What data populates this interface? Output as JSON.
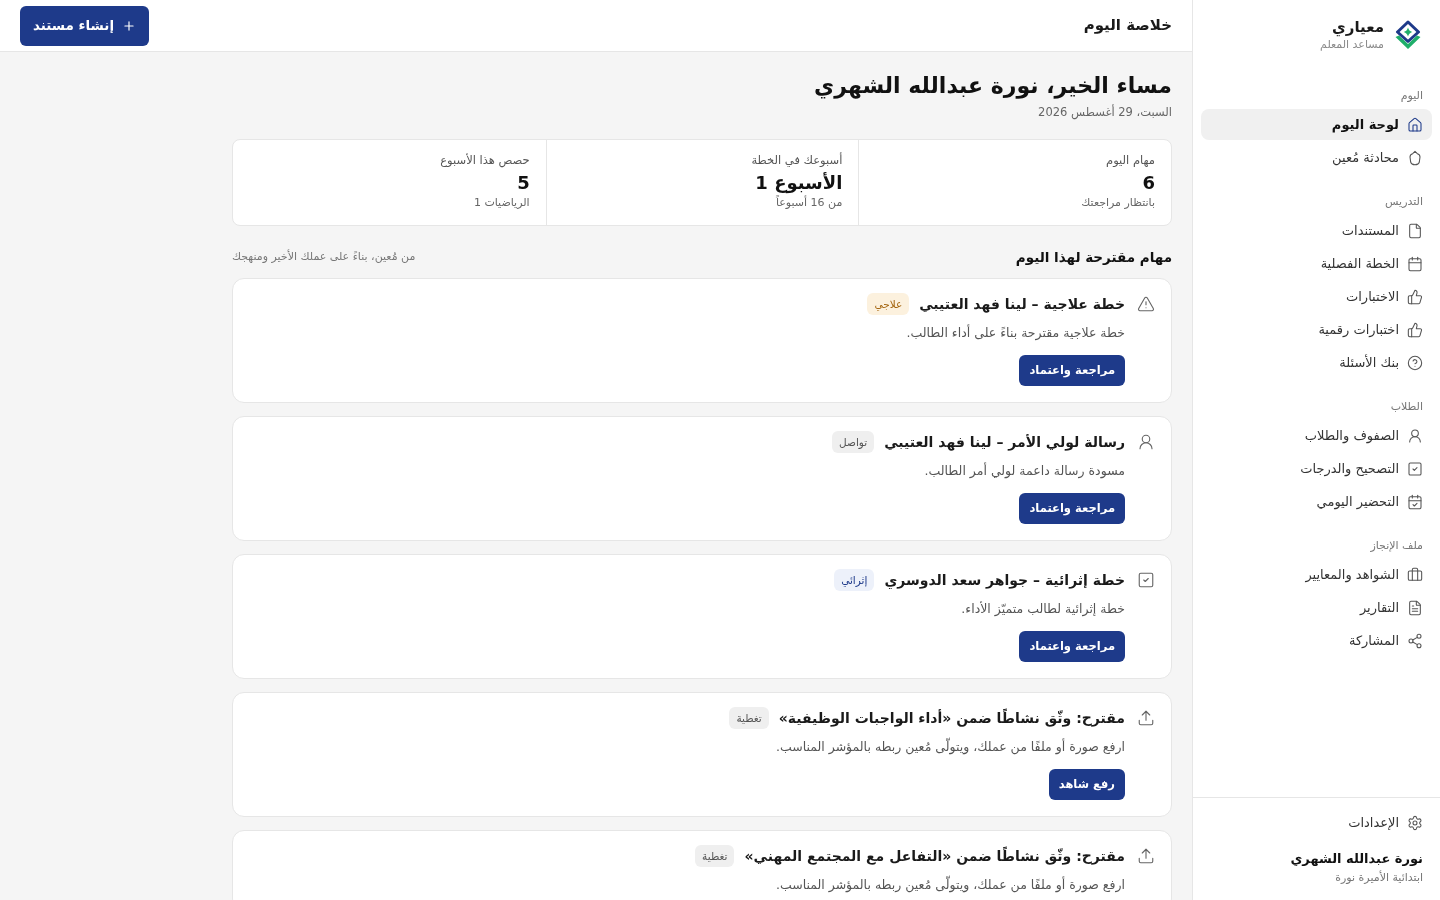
{
  "header": {
    "title": "خلاصة اليوم",
    "action": "إنشاء مستند"
  },
  "sidebar": {
    "brand": {
      "name": "معياري",
      "subtitle": "مساعد المعلم"
    },
    "sections": [
      {
        "label": "اليوم",
        "items": [
          {
            "label": "لوحة اليوم",
            "selected": true
          },
          {
            "label": "محادثة مُعين",
            "selected": false
          }
        ]
      },
      {
        "label": "التدريس",
        "items": [
          {
            "label": "المستندات",
            "selected": false
          },
          {
            "label": "الخطة الفصلية",
            "selected": false
          },
          {
            "label": "الاختبارات",
            "selected": false
          },
          {
            "label": "اختبارات رقمية",
            "selected": false
          },
          {
            "label": "بنك الأسئلة",
            "selected": false
          }
        ]
      },
      {
        "label": "الطلاب",
        "items": [
          {
            "label": "الصفوف والطلاب",
            "selected": false
          },
          {
            "label": "التصحيح والدرجات",
            "selected": false
          },
          {
            "label": "التحضير اليومي",
            "selected": false
          }
        ]
      },
      {
        "label": "ملف الإنجاز",
        "items": [
          {
            "label": "الشواهد والمعايير",
            "selected": false
          },
          {
            "label": "التقارير",
            "selected": false
          },
          {
            "label": "المشاركة",
            "selected": false
          }
        ]
      }
    ],
    "settings": "الإعدادات",
    "user": {
      "name": "نورة عبدالله الشهري",
      "school": "ابتدائية الأميرة نورة"
    }
  },
  "greeting": {
    "title": "مساء الخير، نورة عبدالله الشهري",
    "date": "السبت، 29 أغسطس 2026"
  },
  "stats": [
    {
      "label": "مهام اليوم",
      "value": "6",
      "note": "بانتظار مراجعتك"
    },
    {
      "label": "أسبوعك في الخطة",
      "value": "الأسبوع 1",
      "note": "من 16 أسبوعاً"
    },
    {
      "label": "حصص هذا الأسبوع",
      "value": "5",
      "note": "الرياضيات 1"
    }
  ],
  "suggestions": {
    "title": "مهام مقترحة لهذا اليوم",
    "subtitle": "من مُعين، بناءً على عملك الأخير ومنهجك",
    "tasks": [
      {
        "kind": "remedial",
        "title": "خطة علاجية – لينا فهد العتيبي",
        "tag": "علاجي",
        "description": "خطة علاجية مقترحة بناءً على أداء الطالب.",
        "action": "مراجعة واعتماد"
      },
      {
        "kind": "communication",
        "title": "رسالة لولي الأمر – لينا فهد العتيبي",
        "tag": "تواصل",
        "description": "مسودة رسالة داعمة لولي أمر الطالب.",
        "action": "مراجعة واعتماد"
      },
      {
        "kind": "enrichment",
        "title": "خطة إثرائية – جواهر سعد الدوسري",
        "tag": "إثرائي",
        "description": "خطة إثرائية لطالب متميّز الأداء.",
        "action": "مراجعة واعتماد"
      },
      {
        "kind": "coverage",
        "title": "مقترح: وثّق نشاطًا ضمن «أداء الواجبات الوظيفية»",
        "tag": "تغطية",
        "description": "ارفع صورة أو ملفًا من عملك، ويتولّى مُعين ربطه بالمؤشر المناسب.",
        "action": "رفع شاهد"
      },
      {
        "kind": "coverage",
        "title": "مقترح: وثّق نشاطًا ضمن «التفاعل مع المجتمع المهني»",
        "tag": "تغطية",
        "description": "ارفع صورة أو ملفًا من عملك، ويتولّى مُعين ربطه بالمؤشر المناسب."
      }
    ]
  }
}
